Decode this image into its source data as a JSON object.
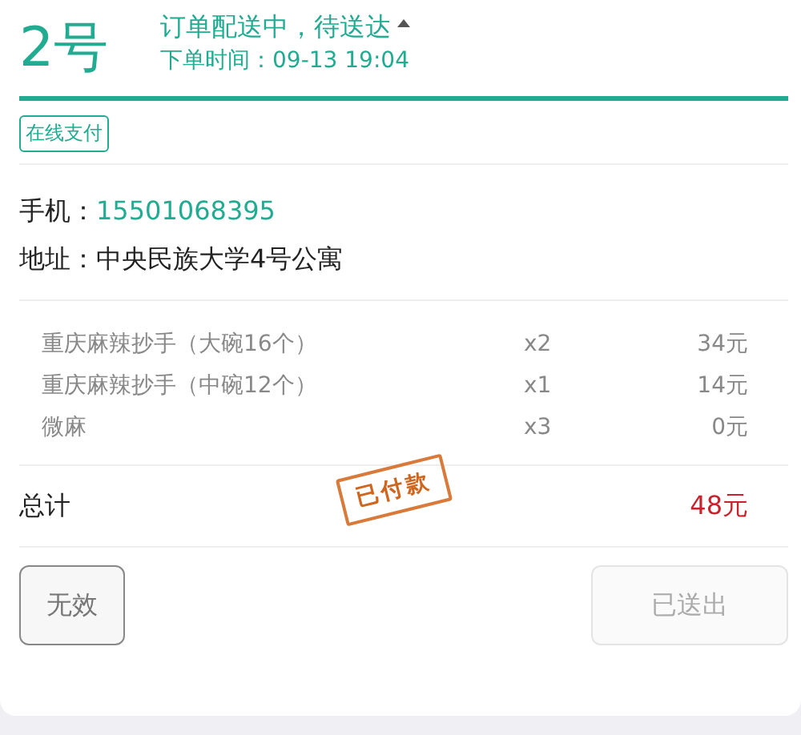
{
  "order": {
    "number": "2号",
    "status": "订单配送中，待送达",
    "time_label": "下单时间：",
    "time": "09-13 19:04"
  },
  "payment_tag": "在线支付",
  "contact": [
    {
      "label": "手机：",
      "value": "15501068395",
      "kind": "link"
    },
    {
      "label": "地址：",
      "value": "中央民族大学4号公寓",
      "kind": "plain"
    }
  ],
  "items": [
    {
      "name": "重庆麻辣抄手（大碗16个）",
      "qty": "x2",
      "price": "34元"
    },
    {
      "name": "重庆麻辣抄手（中碗12个）",
      "qty": "x1",
      "price": "14元"
    },
    {
      "name": "微麻",
      "qty": "x3",
      "price": "0元"
    }
  ],
  "total": {
    "label": "总计",
    "value": "48元"
  },
  "stamp": "已付款",
  "buttons": [
    {
      "label": "无效",
      "disabled": false
    },
    {
      "label": "已送出",
      "disabled": true
    }
  ]
}
